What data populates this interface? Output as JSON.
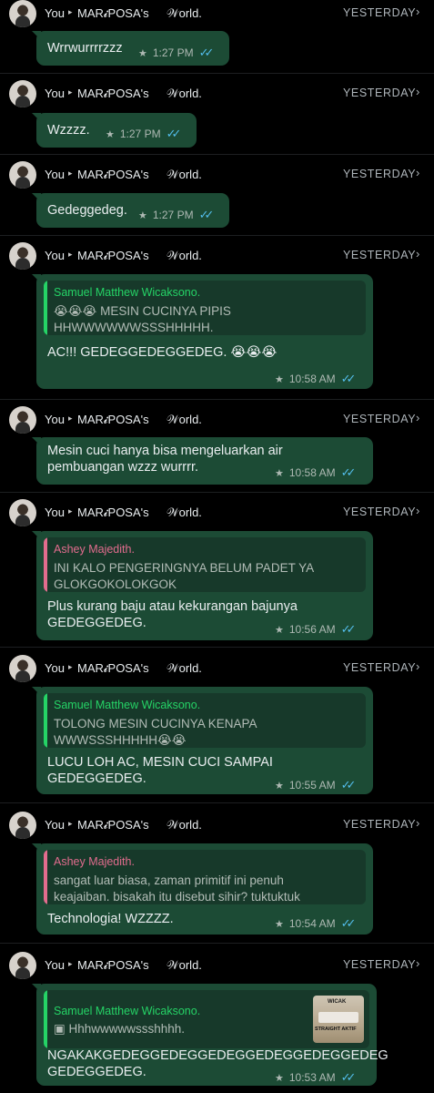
{
  "header": {
    "from": "You",
    "arrow": "▸",
    "to": "MAR𝓲POSA's",
    "world": "𝒲orld.",
    "day": "YESTERDAY",
    "chevron": "›"
  },
  "icons": {
    "star": "star-icon",
    "read_ticks": "double-check-icon"
  },
  "colors": {
    "bubble": "#1c4b35",
    "quote_green": "#25d366",
    "quote_pink": "#e26c8e",
    "ticks": "#53bdeb"
  },
  "messages": [
    {
      "text": "Wrrwurrrrzzz",
      "time": "1:27 PM"
    },
    {
      "text": "Wzzzz.",
      "time": "1:27 PM"
    },
    {
      "text": "Gedeggedeg.",
      "time": "1:27 PM"
    },
    {
      "quote_name": "Samuel Matthew Wicaksono.",
      "quote_lines": [
        "😭😭😭 MESIN CUCINYA PIPIS",
        "HHWWWWWWSSSHHHHH."
      ],
      "lines": [
        "AC!!! GEDEGGEDEGGEDEG. 😭😭😭"
      ],
      "time": "10:58 AM"
    },
    {
      "lines": [
        "Mesin cuci hanya bisa mengeluarkan air",
        "pembuangan wzzz wurrrr."
      ],
      "time": "10:58 AM"
    },
    {
      "quote_name": "Ashey Majedith.",
      "quote_lines": [
        "INI KALO PENGERINGNYA BELUM PADET YA",
        "GLOKGOKOLOKGOK"
      ],
      "lines": [
        "Plus kurang baju atau kekurangan bajunya",
        "GEDEGGEDEG."
      ],
      "time": "10:56 AM"
    },
    {
      "quote_name": "Samuel Matthew Wicaksono.",
      "quote_lines": [
        "TOLONG MESIN CUCINYA KENAPA",
        "WWWSSSHHHHH😭😭"
      ],
      "lines": [
        "LUCU LOH AC, MESIN CUCI SAMPAI GEDEGGEDEG."
      ],
      "time": "10:55 AM"
    },
    {
      "quote_name": "Ashey Majedith.",
      "quote_lines": [
        "sangat luar biasa, zaman primitif ini penuh",
        "keajaiban. bisakah itu disebut sihir? tuktuktuk"
      ],
      "lines": [
        "Technologia! WZZZZ."
      ],
      "time": "10:54 AM"
    },
    {
      "quote_name": "Samuel Matthew Wicaksono.",
      "quote_lines": [
        "▣ Hhhwwwwwssshhhh."
      ],
      "thumb_labels": [
        "WICAK",
        "STRAIGHT AKTIF"
      ],
      "lines": [
        "NGAKAKGEDEGGEDEGGEDEGGEDEGGEDEGGEDEG",
        "GEDEGGEDEG."
      ],
      "time": "10:53 AM"
    }
  ]
}
